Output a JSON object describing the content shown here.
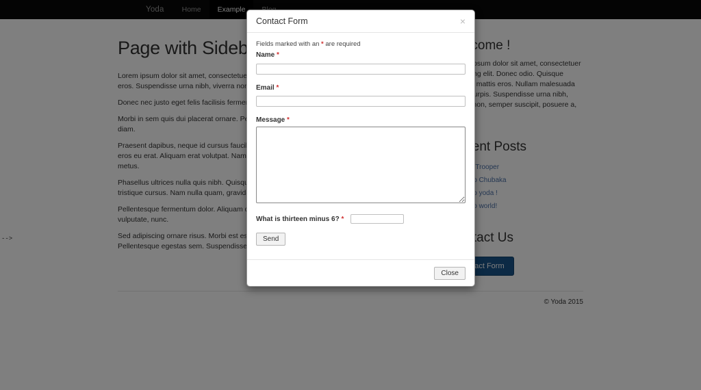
{
  "navbar": {
    "brand": "Yoda",
    "items": [
      {
        "label": "Home",
        "active": false
      },
      {
        "label": "Example",
        "active": true
      },
      {
        "label": "Blog",
        "active": false
      }
    ]
  },
  "main": {
    "title": "Page with Sidebar",
    "paragraphs": [
      "Lorem ipsum dolor sit amet, consectetuer adipiscing elit. Donec odio. Quisque volutpat mattis eros. Suspendisse urna nibh, viverra non, semper suscipit, posuere a, pede.",
      "Donec nec justo eget felis facilisis fermentum. Aliquam porttitor mauris sit amet orci.",
      "Morbi in sem quis dui placerat ornare. Pellentesque odio nisi, euismod in, pharetra a, ultricies in, diam.",
      "Praesent dapibus, neque id cursus faucibus, tortor neque egestas augue, eu vulputate magna eros eu erat. Aliquam erat volutpat. Nam dui mi, tincidunt quis, accumsan porttitor, facilisis luctus, metus.",
      "Phasellus ultrices nulla quis nibh. Quisque a lectus. Donec consectetuer ligula vulputate sem tristique cursus. Nam nulla quam, gravida non, commodo a, sodales sit amet, nisi.",
      "Pellentesque fermentum dolor. Aliquam quam lectus, facilisis auctor, ultrices ut, elementum vulputate, nunc.",
      "Sed adipiscing ornare risus. Morbi est est, blandit sit amet, sagittis vel, euismod vel, velit. Pellentesque egestas sem. Suspendisse commodo ullamcorper magna."
    ]
  },
  "sidebar": {
    "welcome_title": "Welcome !",
    "welcome_text": "Lorem ipsum dolor sit amet, consectetuer adipiscing elit. Donec odio. Quisque volutpat mattis eros. Nullam malesuada erat ut turpis. Suspendisse urna nibh, viverra non, semper suscipit, posuere a, pede.",
    "recent_title": "Recent Posts",
    "recent_posts": [
      "Sup Trooper",
      "Hello Chubaka",
      "Hello yoda !",
      "Hello world!"
    ],
    "contact_title": "Contact Us",
    "contact_button": "Contact Form"
  },
  "footer": {
    "copyright": "© Yoda 2015",
    "stray_markup": "-->"
  },
  "modal": {
    "title": "Contact Form",
    "close_icon": "×",
    "required_note_prefix": "Fields marked with an ",
    "required_marker": "*",
    "required_note_suffix": " are required",
    "fields": {
      "name_label": "Name",
      "name_value": "",
      "email_label": "Email",
      "email_value": "",
      "message_label": "Message",
      "message_value": "",
      "captcha_label": "What is thirteen minus 6?",
      "captcha_value": ""
    },
    "send_label": "Send",
    "close_label": "Close"
  },
  "colors": {
    "navbar_bg": "#080808",
    "accent_button": "#18548a",
    "required_red": "#d03030",
    "link_blue": "#4a6fa5"
  }
}
